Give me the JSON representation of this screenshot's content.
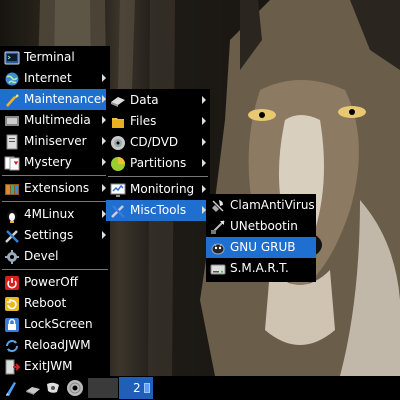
{
  "main_menu": {
    "items": [
      {
        "label": "Terminal",
        "icon": "terminal-icon",
        "submenu": false
      },
      {
        "label": "Internet",
        "icon": "globe-icon",
        "submenu": true
      },
      {
        "label": "Maintenance",
        "icon": "wrench-icon",
        "submenu": true,
        "active": true
      },
      {
        "label": "Multimedia",
        "icon": "film-icon",
        "submenu": true
      },
      {
        "label": "Miniserver",
        "icon": "server-icon",
        "submenu": true
      },
      {
        "label": "Mystery",
        "icon": "cards-icon",
        "submenu": true
      },
      {
        "label": "Extensions",
        "icon": "extensions-icon",
        "submenu": true
      },
      {
        "label": "4MLinux",
        "icon": "penguin-icon",
        "submenu": true
      },
      {
        "label": "Settings",
        "icon": "tools-icon",
        "submenu": true
      },
      {
        "label": "Devel",
        "icon": "gear-icon",
        "submenu": false
      },
      {
        "label": "PowerOff",
        "icon": "power-icon",
        "submenu": false
      },
      {
        "label": "Reboot",
        "icon": "reboot-icon",
        "submenu": false
      },
      {
        "label": "LockScreen",
        "icon": "lock-icon",
        "submenu": false
      },
      {
        "label": "ReloadJWM",
        "icon": "reload-icon",
        "submenu": false
      },
      {
        "label": "ExitJWM",
        "icon": "exit-icon",
        "submenu": false
      }
    ]
  },
  "maintenance_menu": {
    "items": [
      {
        "label": "Data",
        "icon": "data-icon",
        "submenu": true
      },
      {
        "label": "Files",
        "icon": "files-icon",
        "submenu": true
      },
      {
        "label": "CD/DVD",
        "icon": "disc-icon",
        "submenu": true
      },
      {
        "label": "Partitions",
        "icon": "partitions-icon",
        "submenu": true
      },
      {
        "label": "Monitoring",
        "icon": "monitor-icon",
        "submenu": true
      },
      {
        "label": "MiscTools",
        "icon": "tools-icon",
        "submenu": true,
        "active": true
      }
    ]
  },
  "misc_menu": {
    "items": [
      {
        "label": "ClamAntiVirus",
        "icon": "clamav-icon"
      },
      {
        "label": "UNetbootin",
        "icon": "unetbootin-icon"
      },
      {
        "label": "GNU GRUB",
        "icon": "grub-icon",
        "active": true
      },
      {
        "label": "S.M.A.R.T.",
        "icon": "harddisk-icon"
      }
    ]
  },
  "taskbar": {
    "active_desktop": "2"
  },
  "colors": {
    "menu_bg": "#000000",
    "highlight": "#1f6fd0",
    "text": "#ffffff"
  }
}
